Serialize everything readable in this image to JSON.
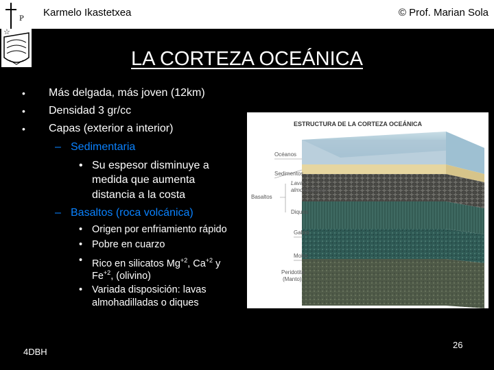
{
  "header": {
    "school": "Karmelo Ikastetxea",
    "author": "© Prof. Marian Sola"
  },
  "slide": {
    "title": "LA CORTEZA OCEÁNICA",
    "bullet_char": "•",
    "dash_char": "–",
    "bullets": [
      "Más delgada, más joven (12km)",
      "Densidad 3 gr/cc",
      "Capas (exterior a interior)"
    ],
    "sub1": "Sedimentaria",
    "sub1_detail": [
      "Su espesor disminuye a",
      "medida que aumenta",
      "distancia a la costa"
    ],
    "sub2": "Basaltos (roca volcánica)",
    "sub2_items": {
      "i1": "Origen por enfriamiento rápido",
      "i2": "Pobre en cuarzo",
      "i3a": "Rico en silicatos Mg",
      "i3_sup1": "+2",
      "i3b": ", Ca",
      "i3_sup2": "+2",
      "i3c": " y",
      "i3d": "Fe",
      "i3_sup3": "+2",
      "i3e": ", (olivino)",
      "i4a": "Variada disposición: lavas",
      "i4b": "almohadilladas o diques"
    }
  },
  "figure": {
    "title": "ESTRUCTURA DE LA CORTEZA OCEÁNICA",
    "labels": {
      "oceanos": "Océanos",
      "sedimentos": "Sedimentos",
      "lavas1": "Lavas",
      "lavas2": "almohadilladas*",
      "basaltos": "Basaltos",
      "diques": "Diques",
      "gabro": "Gabro",
      "moho": "Moho",
      "peridotita1": "Peridotita",
      "peridotita2": "(Manto)"
    }
  },
  "footer": {
    "left": "4DBH",
    "page": "26"
  }
}
